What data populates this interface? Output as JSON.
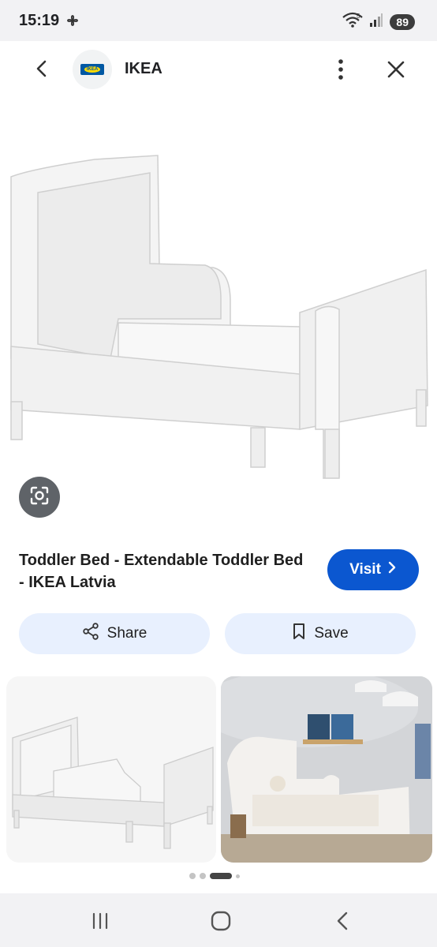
{
  "status_bar": {
    "time": "15:19",
    "battery": "89",
    "icons": [
      "pinwheel-icon",
      "wifi-icon",
      "signal-icon",
      "battery-icon"
    ]
  },
  "header": {
    "site_name": "IKEA",
    "logo_text": "IKEA",
    "icons": [
      "back-arrow-icon",
      "more-vert-icon",
      "close-icon"
    ]
  },
  "result": {
    "title": "Toddler Bed - Extendable Toddler Bed - IKEA Latvia",
    "visit_label": "Visit",
    "share_label": "Share",
    "save_label": "Save"
  },
  "pager": {
    "dots": 4,
    "active_index": 2
  },
  "colors": {
    "accent": "#0b57d0",
    "chip_bg": "#e8f0fe",
    "system_bar": "#f2f2f4",
    "lens_bg": "#5f6368"
  },
  "nav_bar": {
    "icons": [
      "recents-icon",
      "home-icon",
      "back-icon"
    ]
  }
}
